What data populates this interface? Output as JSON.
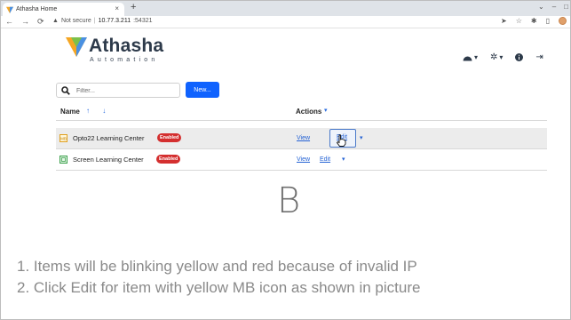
{
  "browser": {
    "tab_title": "Athasha Home",
    "tab_close": "×",
    "new_tab": "+",
    "security_label": "Not secure",
    "url_separator": "|",
    "url_host": "10.77.3.211",
    "url_port": ":54321",
    "window_controls": [
      "⌄",
      "–",
      "□"
    ]
  },
  "app": {
    "logo_name": "Athasha",
    "logo_sub": "Automation",
    "brand_colors": [
      "#f5a623",
      "#4a90e2"
    ]
  },
  "toolbar": {
    "search_placeholder": "Filter...",
    "new_label": "New..."
  },
  "table": {
    "col_name": "Name",
    "sort_arrows": "↑ ↓",
    "col_actions": "Actions",
    "actions_caret": "▾",
    "rows": [
      {
        "name": "Opto22 Learning Center",
        "badge": "Enabled",
        "view": "View",
        "edit": "Edit",
        "more": "▾",
        "icon_color": "#e0a020",
        "highlighted": true
      },
      {
        "name": "Screen Learning Center",
        "badge": "Enabled",
        "view": "View",
        "edit": "Edit",
        "more": "▾",
        "icon_color": "#3aa04a",
        "highlighted": false
      }
    ]
  },
  "caption": {
    "letter": "B",
    "line1": "1. Items will be blinking yellow and red because of invalid IP",
    "line2": "2. Click Edit for item with yellow MB icon as shown in picture"
  }
}
